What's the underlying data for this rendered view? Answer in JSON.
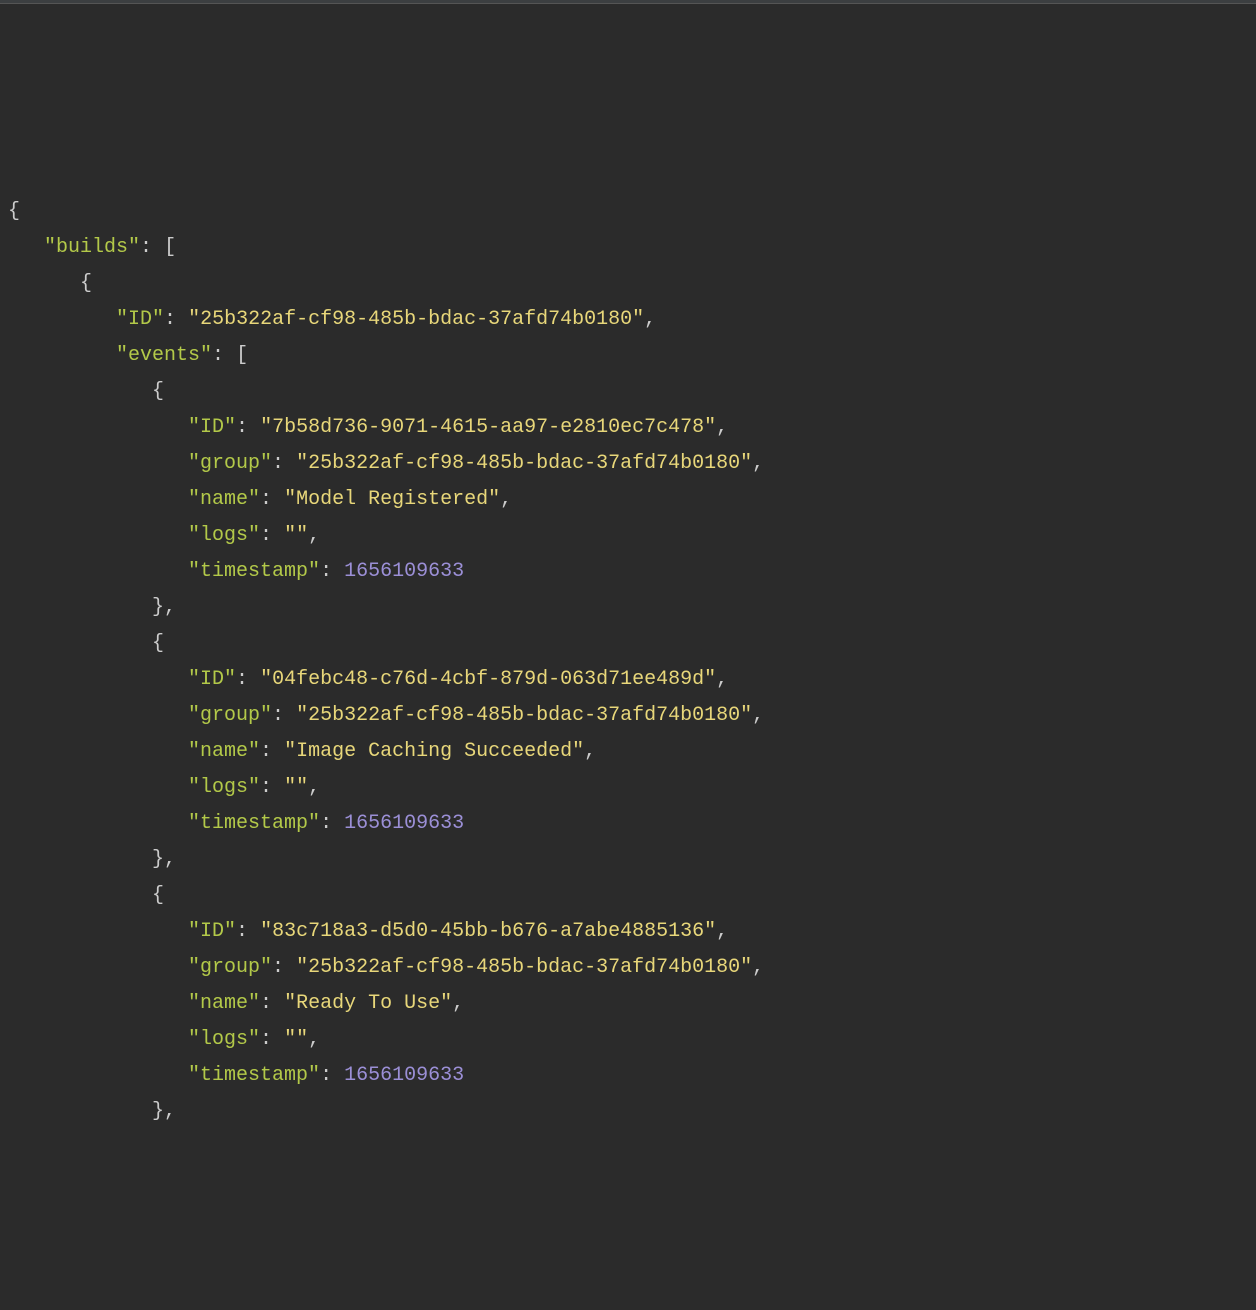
{
  "indent": "   ",
  "json": {
    "builds": [
      {
        "ID": "25b322af-cf98-485b-bdac-37afd74b0180",
        "events": [
          {
            "ID": "7b58d736-9071-4615-aa97-e2810ec7c478",
            "group": "25b322af-cf98-485b-bdac-37afd74b0180",
            "name": "Model Registered",
            "logs": "",
            "timestamp": 1656109633
          },
          {
            "ID": "04febc48-c76d-4cbf-879d-063d71ee489d",
            "group": "25b322af-cf98-485b-bdac-37afd74b0180",
            "name": "Image Caching Succeeded",
            "logs": "",
            "timestamp": 1656109633
          },
          {
            "ID": "83c718a3-d5d0-45bb-b676-a7abe4885136",
            "group": "25b322af-cf98-485b-bdac-37afd74b0180",
            "name": "Ready To Use",
            "logs": "",
            "timestamp": 1656109633
          }
        ]
      }
    ]
  }
}
